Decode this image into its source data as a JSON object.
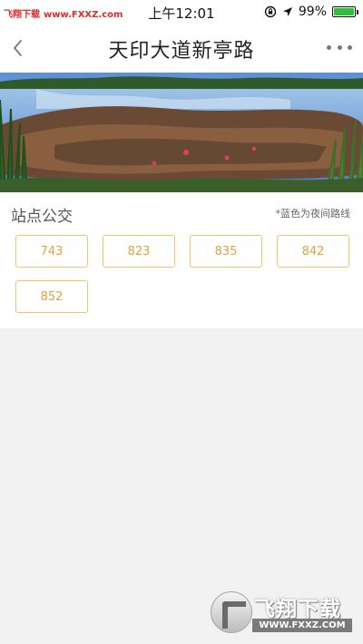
{
  "status_bar": {
    "watermark_left": "飞翔下载",
    "watermark_url": "www.FXXZ.com",
    "time": "上午12:01",
    "battery": "99%",
    "battery_level": 0.99,
    "icons": [
      "rotation-lock-icon",
      "location-arrow-icon",
      "battery-icon"
    ]
  },
  "header": {
    "title": "天印大道新亭路",
    "back_icon": "chevron-left-icon",
    "more_icon": "more-dots-icon"
  },
  "banner": {
    "description_icon": "landscape-photo"
  },
  "stop_bus": {
    "title": "站点公交",
    "note": "*蓝色为夜间路线",
    "routes": [
      "743",
      "823",
      "835",
      "842",
      "852"
    ],
    "route_text_color": "#e0a23c",
    "route_border_color": "#efc56b"
  },
  "watermark": {
    "cn": "飞翔下载",
    "url": "WWW.FXXZ.COM"
  }
}
